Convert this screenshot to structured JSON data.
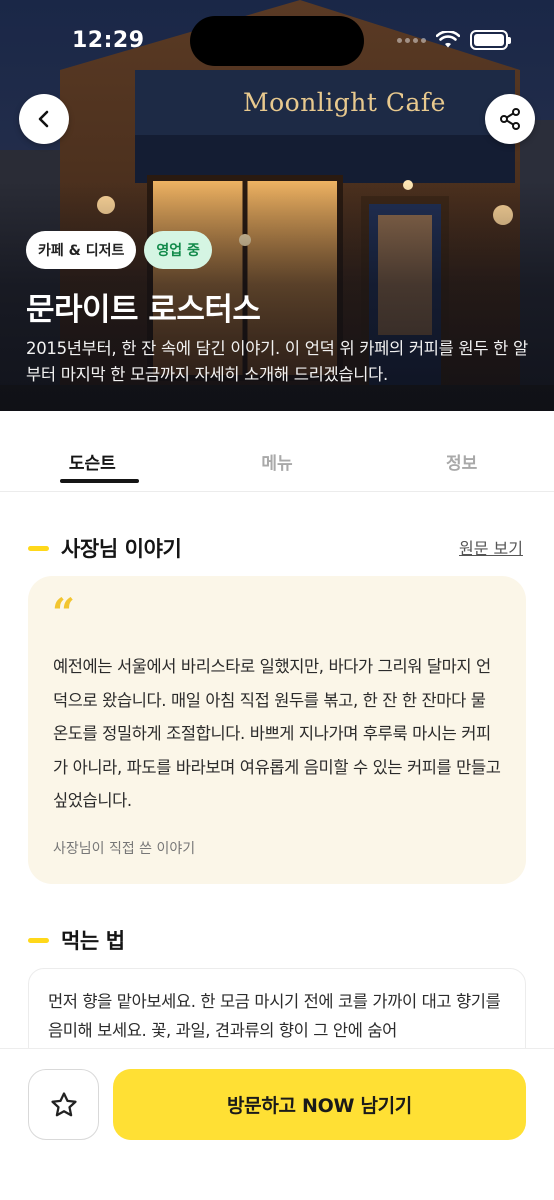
{
  "status_bar": {
    "time": "12:29"
  },
  "hero": {
    "sign_text": "Moonlight Cafe",
    "tags": {
      "category": "카페 & 디저트",
      "status": "영업 중"
    },
    "title": "문라이트 로스터스",
    "description": "2015년부터, 한 잔 속에 담긴 이야기. 이 언덕 위 카페의 커피를 원두 한 알부터 마지막 한 모금까지 자세히 소개해 드리겠습니다."
  },
  "tabs": [
    {
      "label": "도슨트",
      "active": true
    },
    {
      "label": "메뉴",
      "active": false
    },
    {
      "label": "정보",
      "active": false
    }
  ],
  "story_section": {
    "title": "사장님 이야기",
    "link": "원문 보기",
    "quote_mark": "“",
    "text": "예전에는 서울에서 바리스타로 일했지만, 바다가 그리워 달마지 언덕으로 왔습니다. 매일 아침 직접 원두를 볶고, 한 잔 한 잔마다 물 온도를 정밀하게 조절합니다. 바쁘게 지나가며 후루룩 마시는 커피가 아니라, 파도를 바라보며 여유롭게 음미할 수 있는 커피를 만들고 싶었습니다.",
    "note": "사장님이 직접 쓴 이야기"
  },
  "how_section": {
    "title": "먹는 법",
    "text": "먼저 향을 맡아보세요. 한 모금 마시기 전에 코를 가까이 대고 향기를 음미해 보세요. 꽃, 과일, 견과류의 향이 그 안에 숨어"
  },
  "bottom_bar": {
    "cta_label": "방문하고 NOW 남기기"
  },
  "colors": {
    "accent": "#ffe034",
    "open_badge_bg": "#d5f5e3",
    "open_badge_text": "#118a4a",
    "story_bg": "#fbf6e8"
  }
}
